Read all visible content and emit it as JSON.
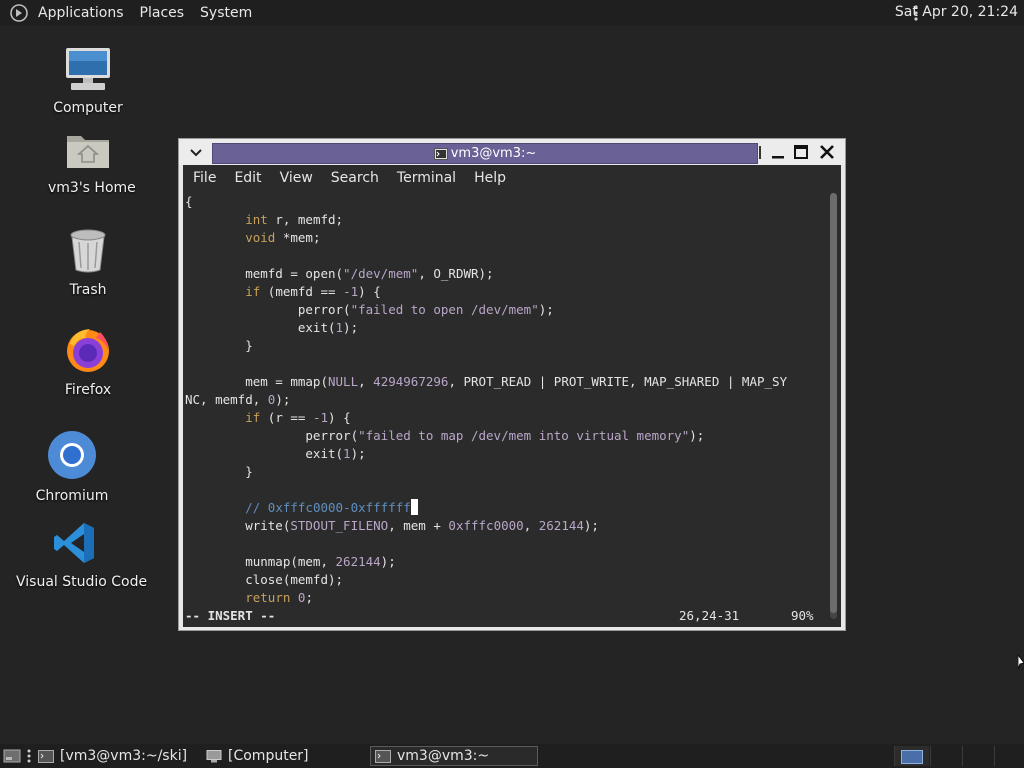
{
  "top_panel": {
    "menus": [
      "Applications",
      "Places",
      "System"
    ],
    "clock": "Sat Apr 20, 21:24"
  },
  "desktop_icons": [
    {
      "label": "Computer",
      "icon": "computer-icon"
    },
    {
      "label": "vm3's Home",
      "icon": "home-folder-icon"
    },
    {
      "label": "Trash",
      "icon": "trash-icon"
    },
    {
      "label": "Firefox",
      "icon": "firefox-icon"
    },
    {
      "label": "Chromium",
      "icon": "chromium-icon"
    },
    {
      "label": "Visual Studio Code",
      "icon": "vscode-icon"
    }
  ],
  "terminal": {
    "title": "vm3@vm3:~",
    "menu": [
      "File",
      "Edit",
      "View",
      "Search",
      "Terminal",
      "Help"
    ],
    "lines": [
      {
        "segs": [
          {
            "t": "{",
            "c": ""
          }
        ]
      },
      {
        "segs": [
          {
            "t": "        ",
            "c": ""
          },
          {
            "t": "int",
            "c": "ty"
          },
          {
            "t": " r, memfd;",
            "c": ""
          }
        ]
      },
      {
        "segs": [
          {
            "t": "        ",
            "c": ""
          },
          {
            "t": "void",
            "c": "ty"
          },
          {
            "t": " *mem;",
            "c": ""
          }
        ]
      },
      {
        "segs": [
          {
            "t": "",
            "c": ""
          }
        ]
      },
      {
        "segs": [
          {
            "t": "        memfd = open(",
            "c": ""
          },
          {
            "t": "\"/dev/mem\"",
            "c": "str"
          },
          {
            "t": ", O_RDWR);",
            "c": ""
          }
        ]
      },
      {
        "segs": [
          {
            "t": "        ",
            "c": ""
          },
          {
            "t": "if",
            "c": "kw"
          },
          {
            "t": " (memfd == ",
            "c": ""
          },
          {
            "t": "-1",
            "c": "num"
          },
          {
            "t": ") {",
            "c": ""
          }
        ]
      },
      {
        "segs": [
          {
            "t": "               perror(",
            "c": ""
          },
          {
            "t": "\"failed to open /dev/mem\"",
            "c": "str"
          },
          {
            "t": ");",
            "c": ""
          }
        ]
      },
      {
        "segs": [
          {
            "t": "               exit(",
            "c": ""
          },
          {
            "t": "1",
            "c": "num"
          },
          {
            "t": ");",
            "c": ""
          }
        ]
      },
      {
        "segs": [
          {
            "t": "        }",
            "c": ""
          }
        ]
      },
      {
        "segs": [
          {
            "t": "",
            "c": ""
          }
        ]
      },
      {
        "segs": [
          {
            "t": "        mem = mmap(",
            "c": ""
          },
          {
            "t": "NULL",
            "c": "str"
          },
          {
            "t": ", ",
            "c": ""
          },
          {
            "t": "4294967296",
            "c": "num"
          },
          {
            "t": ", PROT_READ | PROT_WRITE, MAP_SHARED | MAP_SY",
            "c": ""
          }
        ]
      },
      {
        "segs": [
          {
            "t": "NC, memfd, ",
            "c": ""
          },
          {
            "t": "0",
            "c": "num"
          },
          {
            "t": ");",
            "c": ""
          }
        ]
      },
      {
        "segs": [
          {
            "t": "        ",
            "c": ""
          },
          {
            "t": "if",
            "c": "kw"
          },
          {
            "t": " (r == ",
            "c": ""
          },
          {
            "t": "-1",
            "c": "num"
          },
          {
            "t": ") {",
            "c": ""
          }
        ]
      },
      {
        "segs": [
          {
            "t": "                perror(",
            "c": ""
          },
          {
            "t": "\"failed to map /dev/mem into virtual memory\"",
            "c": "str"
          },
          {
            "t": ");",
            "c": ""
          }
        ]
      },
      {
        "segs": [
          {
            "t": "                exit(",
            "c": ""
          },
          {
            "t": "1",
            "c": "num"
          },
          {
            "t": ");",
            "c": ""
          }
        ]
      },
      {
        "segs": [
          {
            "t": "        }",
            "c": ""
          }
        ]
      },
      {
        "segs": [
          {
            "t": "",
            "c": ""
          }
        ]
      },
      {
        "segs": [
          {
            "t": "        ",
            "c": ""
          },
          {
            "t": "// 0xfffc0000-0xffffff",
            "c": "cmt"
          },
          {
            "t": "CURSOR",
            "c": "cursor"
          }
        ]
      },
      {
        "segs": [
          {
            "t": "        write(",
            "c": ""
          },
          {
            "t": "STDOUT_FILENO",
            "c": "str"
          },
          {
            "t": ", mem + ",
            "c": ""
          },
          {
            "t": "0xfffc0000",
            "c": "num"
          },
          {
            "t": ", ",
            "c": ""
          },
          {
            "t": "262144",
            "c": "num"
          },
          {
            "t": ");",
            "c": ""
          }
        ]
      },
      {
        "segs": [
          {
            "t": "",
            "c": ""
          }
        ]
      },
      {
        "segs": [
          {
            "t": "        munmap(mem, ",
            "c": ""
          },
          {
            "t": "262144",
            "c": "num"
          },
          {
            "t": ");",
            "c": ""
          }
        ]
      },
      {
        "segs": [
          {
            "t": "        close(memfd);",
            "c": ""
          }
        ]
      },
      {
        "segs": [
          {
            "t": "        ",
            "c": ""
          },
          {
            "t": "return",
            "c": "kw"
          },
          {
            "t": " ",
            "c": ""
          },
          {
            "t": "0",
            "c": "num"
          },
          {
            "t": ";",
            "c": ""
          }
        ]
      }
    ],
    "status_mode": "-- INSERT --",
    "status_position": "26,24-31",
    "status_percent": "90%"
  },
  "taskbar": {
    "tasks": [
      {
        "label": "[vm3@vm3:~/ski]",
        "icon": "terminal-icon",
        "active": false
      },
      {
        "label": "[Computer]",
        "icon": "computer-icon",
        "active": false
      },
      {
        "label": "vm3@vm3:~",
        "icon": "terminal-icon",
        "active": true
      }
    ]
  },
  "colors": {
    "desktop_bg": "#242424",
    "terminal_bg": "#2b2b2b",
    "title_active": "#6a6296",
    "keyword": "#c6a15a",
    "string": "#b9a6c8",
    "comment": "#5f8fbf"
  }
}
